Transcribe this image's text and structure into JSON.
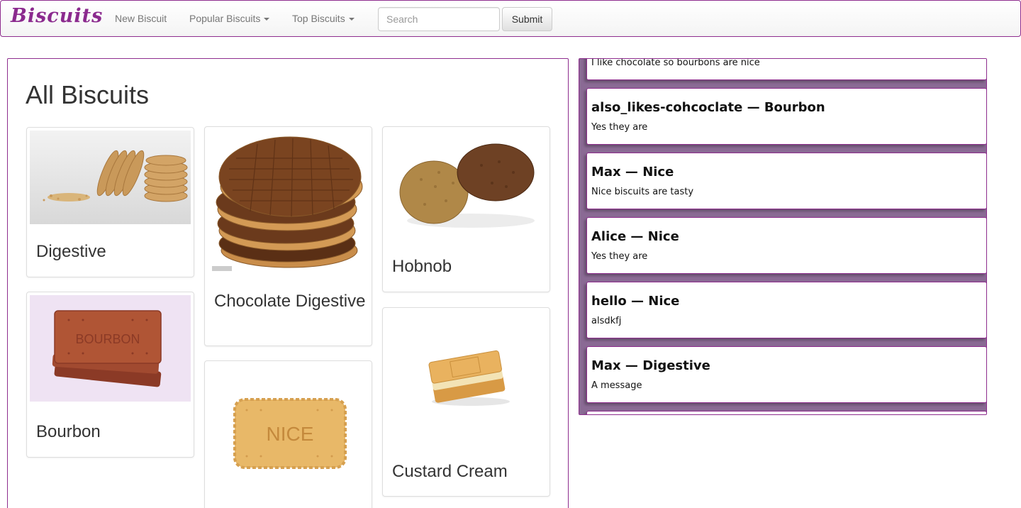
{
  "navbar": {
    "brand": "Biscuits",
    "links": [
      {
        "label": "New Biscuit",
        "has_caret": false
      },
      {
        "label": "Popular Biscuits",
        "has_caret": true
      },
      {
        "label": "Top Biscuits",
        "has_caret": true
      }
    ],
    "search_placeholder": "Search",
    "search_value": "",
    "submit_label": "Submit"
  },
  "main": {
    "title": "All Biscuits",
    "biscuits": [
      {
        "name": "Digestive",
        "icon": "digestive-image"
      },
      {
        "name": "Chocolate Digestive",
        "icon": "chocolate-digestive-image"
      },
      {
        "name": "Hobnob",
        "icon": "hobnob-image"
      },
      {
        "name": "Bourbon",
        "icon": "bourbon-image"
      },
      {
        "name": "Nice",
        "icon": "nice-image"
      },
      {
        "name": "Custard Cream",
        "icon": "custard-cream-image"
      }
    ]
  },
  "messages": [
    {
      "title": "",
      "body": "I like chocolate so bourbons are nice"
    },
    {
      "title": "also_likes-cohcoclate — Bourbon",
      "body": "Yes they are"
    },
    {
      "title": "Max — Nice",
      "body": "Nice biscuits are tasty"
    },
    {
      "title": "Alice — Nice",
      "body": "Yes they are"
    },
    {
      "title": "hello — Nice",
      "body": "alsdkfj"
    },
    {
      "title": "Max — Digestive",
      "body": "A message"
    }
  ],
  "colors": {
    "brand": "#8b2a8e",
    "panel_border": "#8e2d8e",
    "messages_background": "#8a6a94"
  }
}
